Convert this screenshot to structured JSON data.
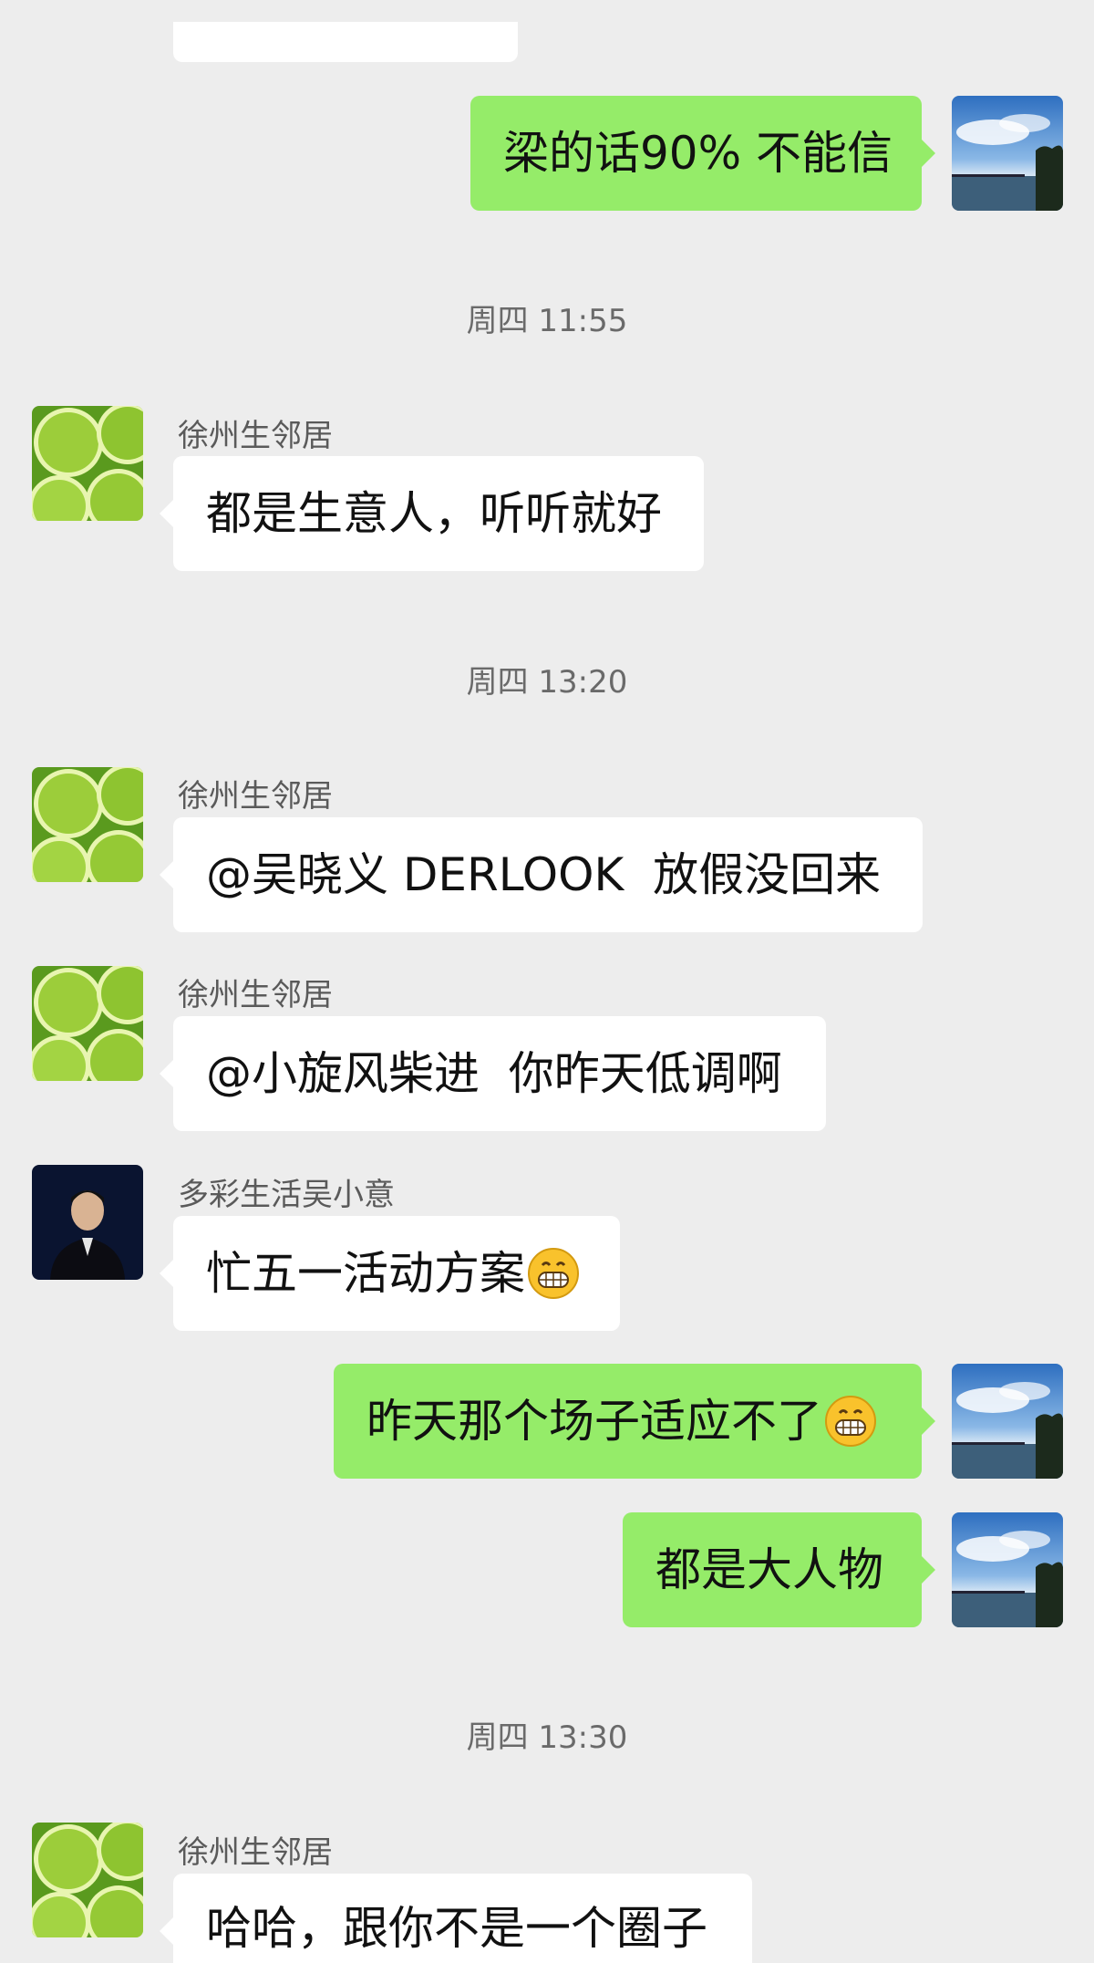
{
  "messages": [
    {
      "type": "text",
      "direction": "out",
      "text": "梁的话90% 不能信"
    },
    {
      "type": "time",
      "text": "周四 11:55"
    },
    {
      "type": "text",
      "direction": "in",
      "sender": "徐州生邻居",
      "text": "都是生意人，听听就好"
    },
    {
      "type": "time",
      "text": "周四 13:20"
    },
    {
      "type": "text",
      "direction": "in",
      "sender": "徐州生邻居",
      "text": "@吴晓义 DERLOOK  放假没回来"
    },
    {
      "type": "text",
      "direction": "in",
      "sender": "徐州生邻居",
      "text": "@小旋风柴进  你昨天低调啊"
    },
    {
      "type": "text",
      "direction": "in",
      "sender": "多彩生活吴小意",
      "text": "忙五一活动方案",
      "emoji": "grinning-face-emoji"
    },
    {
      "type": "text",
      "direction": "out",
      "text": "昨天那个场子适应不了",
      "emoji": "grinning-face-emoji"
    },
    {
      "type": "text",
      "direction": "out",
      "text": "都是大人物"
    },
    {
      "type": "time",
      "text": "周四 13:30"
    },
    {
      "type": "text",
      "direction": "in",
      "sender": "徐州生邻居",
      "text": "哈哈，跟你不是一个圈子"
    }
  ],
  "colors": {
    "background": "#ededed",
    "incoming_bubble": "#ffffff",
    "outgoing_bubble": "#95ec69",
    "timestamp_text": "#6a6a6a",
    "sender_name_text": "#5a5a5a"
  },
  "avatars": {
    "self": "sky-lake-avatar",
    "xuzhou_neighbor": "lime-slices-avatar",
    "wu_xiaoyi": "man-in-suit-avatar"
  }
}
